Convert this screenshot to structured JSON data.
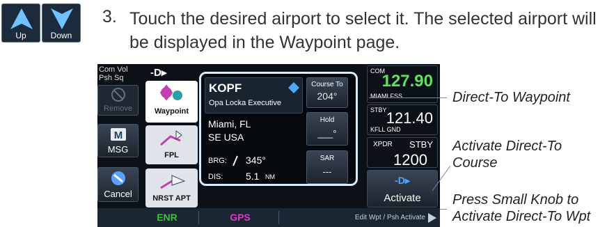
{
  "nav_buttons": {
    "up_label": "Up",
    "down_label": "Down"
  },
  "instruction": {
    "number": "3.",
    "text": "Touch the desired airport to select it. The selected airport will be displayed in the Waypoint page."
  },
  "device": {
    "left_column": {
      "com_vol": "Com Vol Psh Sq",
      "remove": "Remove",
      "msg": "MSG",
      "cancel": "Cancel"
    },
    "direct_to_symbol": "-D▸",
    "tabs": [
      "Waypoint",
      "FPL",
      "NRST APT"
    ],
    "waypoint": {
      "ident": "KOPF",
      "name": "Opa Locka Executive",
      "city": "Miami, FL",
      "region": "SE USA",
      "brg_label": "BRG:",
      "brg_value": "345°",
      "dis_label": "DIS:",
      "dis_value": "5.1",
      "dis_unit": "NM"
    },
    "course_to": {
      "label": "Course To",
      "value": "204°"
    },
    "hold": {
      "label": "Hold",
      "value": "___°"
    },
    "sar": {
      "label": "SAR",
      "value": "---"
    },
    "radio": {
      "com_label": "COM",
      "com_freq": "127.90",
      "com_station": "MIAMI FSS",
      "stby_label": "STBY",
      "stby_freq": "121.40",
      "stby_station": "KFLL GND",
      "xpdr_label": "XPDR",
      "xpdr_mode": "STBY",
      "xpdr_code": "1200"
    },
    "activate_label": "Activate",
    "bottom_bar": {
      "enr": "ENR",
      "gps": "GPS",
      "hint": "Edit Wpt / Psh Activate"
    },
    "colors": {
      "com_green": "#5fe05f",
      "gps_magenta": "#d040c0",
      "enr_green": "#3fbf3f",
      "card_border": "#d8ecff"
    }
  },
  "callouts": {
    "direct_to_waypoint": "Direct-To Waypoint",
    "activate_course": "Activate Direct-To Course",
    "press_knob": "Press Small Knob to Activate Direct-To Wpt"
  }
}
